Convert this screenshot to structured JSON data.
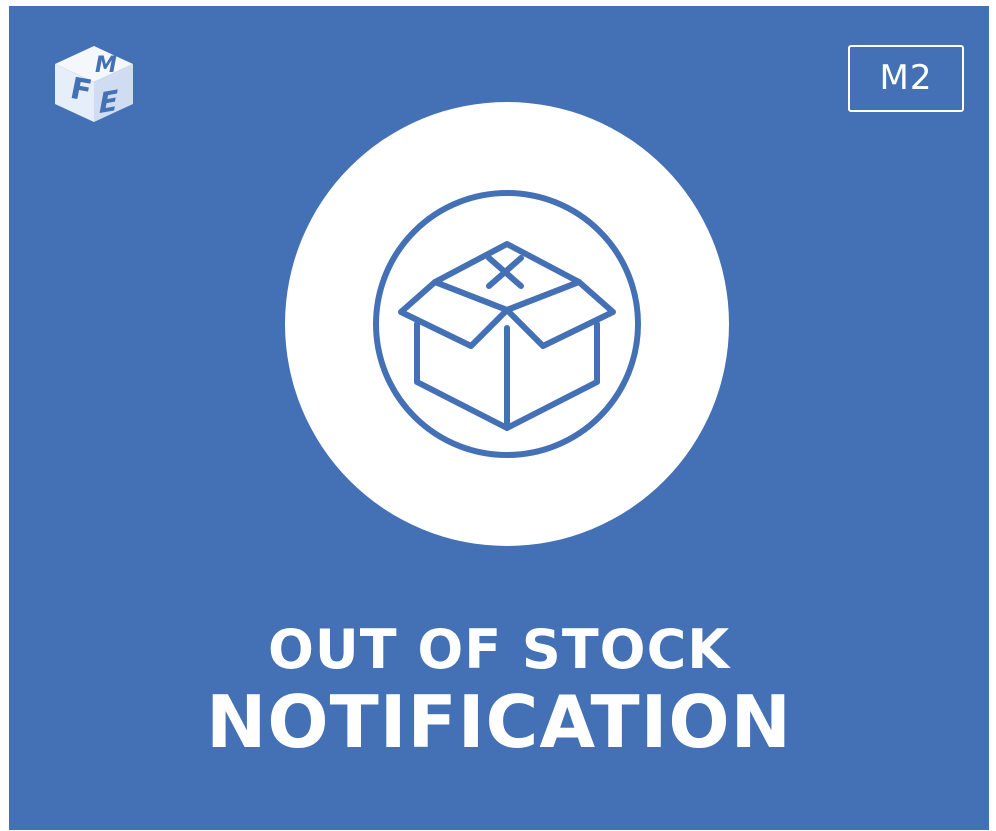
{
  "brand": {
    "logo_icon": "fme-cube-logo-icon",
    "letters": [
      "F",
      "M",
      "E"
    ]
  },
  "badge": {
    "label": "M2"
  },
  "icon": {
    "name": "open-box-with-x-icon"
  },
  "title": {
    "line1": "OUT OF STOCK",
    "line2": "NOTIFICATION"
  },
  "colors": {
    "background": "#4471b5",
    "circle": "#ffffff",
    "icon_stroke": "#4471b5",
    "text": "#ffffff"
  }
}
